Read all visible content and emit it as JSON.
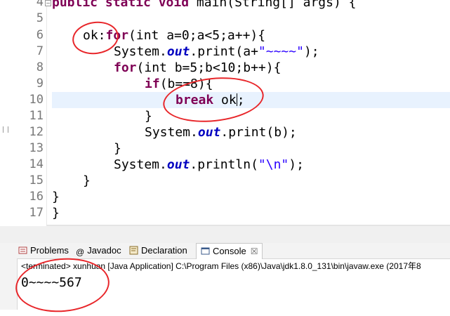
{
  "editor": {
    "line_numbers": [
      "4",
      "5",
      "6",
      "7",
      "8",
      "9",
      "10",
      "11",
      "12",
      "13",
      "14",
      "15",
      "16",
      "17"
    ],
    "lines": {
      "l4": {
        "kw": "public static void",
        "rest": " main(String[] args) {"
      },
      "l6": {
        "label": "ok:",
        "kw": "for",
        "rest": "(int a=0;a<5;a++){"
      },
      "l7": {
        "pre": "System.",
        "fld": "out",
        "mid": ".print(a+",
        "str": "\"~~~~\"",
        "post": ");"
      },
      "l8": {
        "kw": "for",
        "rest": "(int b=5;b<10;b++){"
      },
      "l9": {
        "kw": "if",
        "rest": "(b==8){"
      },
      "l10": {
        "kw": "break",
        "rest": " ok",
        "end": ";"
      },
      "l11": {
        "text": "}"
      },
      "l12": {
        "pre": "System.",
        "fld": "out",
        "post": ".print(b);"
      },
      "l13": {
        "text": "}"
      },
      "l14": {
        "pre": "System.",
        "fld": "out",
        "mid": ".println(",
        "str": "\"\\n\"",
        "post": ");"
      },
      "l15": {
        "text": "}"
      },
      "l16": {
        "text": "}"
      },
      "l17": {
        "text": "}"
      }
    }
  },
  "views": {
    "tabs": [
      {
        "label": "Problems",
        "icon": "problems-icon"
      },
      {
        "label": "Javadoc",
        "icon": "javadoc-icon"
      },
      {
        "label": "Declaration",
        "icon": "declaration-icon"
      },
      {
        "label": "Console",
        "icon": "console-icon",
        "close": "☒"
      }
    ],
    "status": "<terminated> xunhuan [Java Application] C:\\Program Files (x86)\\Java\\jdk1.8.0_131\\bin\\javaw.exe (2017年8",
    "console_output": "0~~~~567"
  },
  "colors": {
    "annotation": "#e8262a",
    "keyword": "#7f0055",
    "field": "#0000c0",
    "string": "#2a00ff"
  }
}
